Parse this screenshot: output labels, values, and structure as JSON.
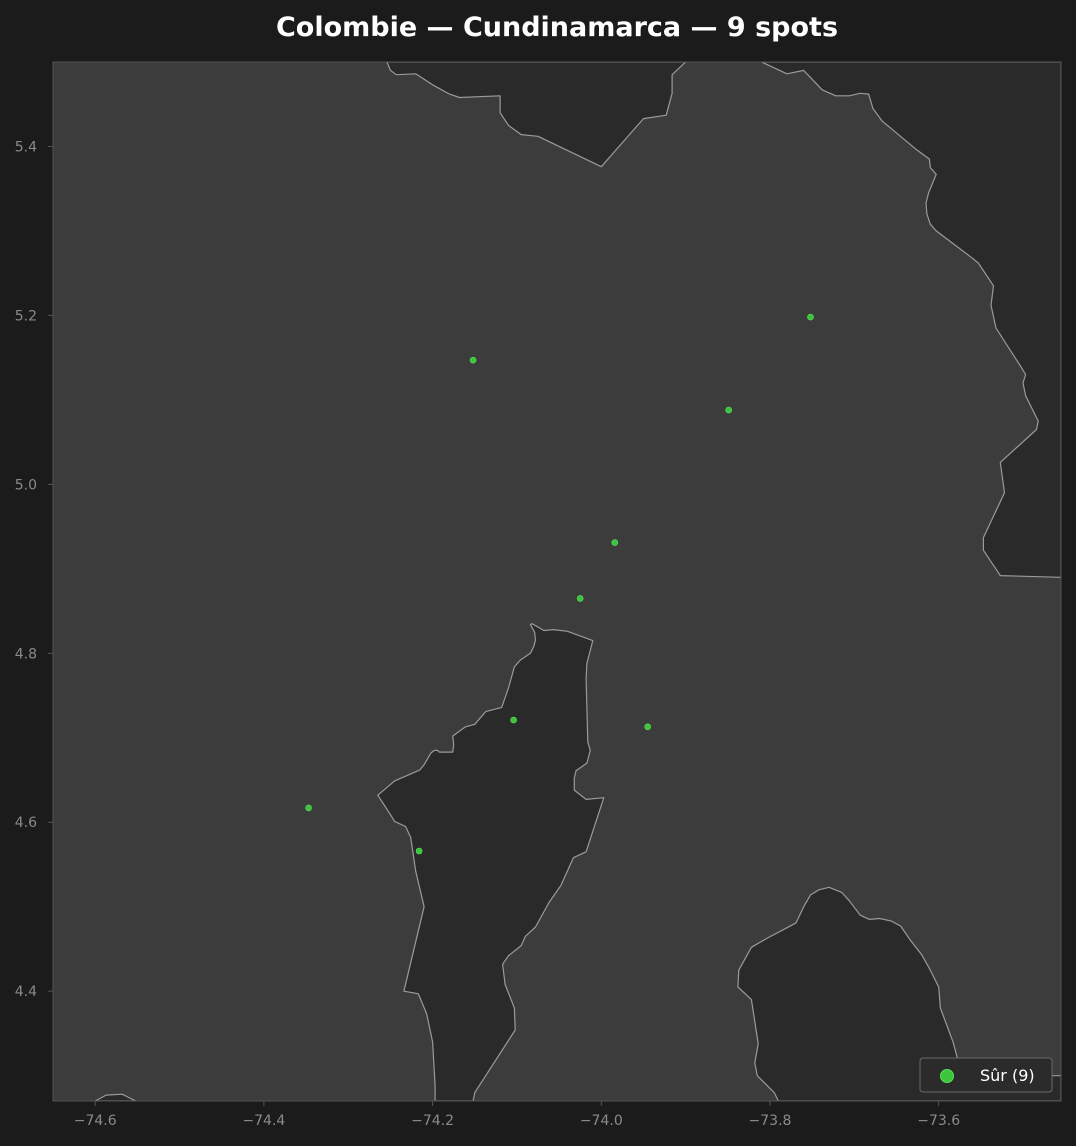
{
  "title": "Colombie — Cundinamarca — 9 spots",
  "colors": {
    "background": "#1b1b1b",
    "region_fill": "#3c3c3c",
    "neighbor_fill": "#2a2a2a",
    "border_stroke": "#9a9a9a",
    "spot": "#3cc43c",
    "spot_edge": "#5ee05e",
    "axis": "#555555",
    "tick_label": "#8a8a8a"
  },
  "chart_data": {
    "type": "scatter",
    "title": "Colombie — Cundinamarca — 9 spots",
    "xlabel": "",
    "ylabel": "",
    "xlim": [
      -74.65,
      -73.455
    ],
    "ylim": [
      4.27,
      5.5
    ],
    "x_ticks": [
      -74.6,
      -74.4,
      -74.2,
      -74.0,
      -73.8,
      -73.6
    ],
    "x_tick_labels": [
      "−74.6",
      "−74.4",
      "−74.2",
      "−74.0",
      "−73.8",
      "−73.6"
    ],
    "y_ticks": [
      4.4,
      4.6,
      4.8,
      5.0,
      5.2,
      5.4
    ],
    "y_tick_labels": [
      "4.4",
      "4.6",
      "4.8",
      "5.0",
      "5.2",
      "5.4"
    ],
    "grid": false,
    "legend_position": "bottom-right",
    "series": [
      {
        "name": "Sûr (9)",
        "color": "#3cc43c",
        "points": [
          {
            "lon": -74.152,
            "lat": 5.147
          },
          {
            "lon": -73.752,
            "lat": 5.198
          },
          {
            "lon": -73.849,
            "lat": 5.088
          },
          {
            "lon": -73.984,
            "lat": 4.931
          },
          {
            "lon": -74.025,
            "lat": 4.865
          },
          {
            "lon": -74.104,
            "lat": 4.721
          },
          {
            "lon": -73.945,
            "lat": 4.713
          },
          {
            "lon": -74.347,
            "lat": 4.617
          },
          {
            "lon": -74.216,
            "lat": 4.566
          }
        ]
      }
    ],
    "neighbor_regions": [
      {
        "name": "north-neighbor-west",
        "coords": [
          [
            -74.254,
            5.5
          ],
          [
            -74.25,
            5.49
          ],
          [
            -74.243,
            5.485
          ],
          [
            -74.22,
            5.486
          ],
          [
            -74.2,
            5.473
          ],
          [
            -74.18,
            5.462
          ],
          [
            -74.168,
            5.458
          ],
          [
            -74.12,
            5.46
          ],
          [
            -74.12,
            5.44
          ],
          [
            -74.11,
            5.425
          ],
          [
            -74.095,
            5.414
          ],
          [
            -74.075,
            5.412
          ],
          [
            -74.0,
            5.376
          ],
          [
            -73.95,
            5.433
          ],
          [
            -73.923,
            5.437
          ],
          [
            -73.916,
            5.463
          ],
          [
            -73.916,
            5.485
          ],
          [
            -73.9,
            5.5
          ]
        ]
      },
      {
        "name": "northeast-neighbor",
        "coords": [
          [
            -73.81,
            5.5
          ],
          [
            -73.78,
            5.486
          ],
          [
            -73.76,
            5.49
          ],
          [
            -73.738,
            5.467
          ],
          [
            -73.722,
            5.46
          ],
          [
            -73.706,
            5.46
          ],
          [
            -73.693,
            5.463
          ],
          [
            -73.683,
            5.462
          ],
          [
            -73.678,
            5.445
          ],
          [
            -73.667,
            5.43
          ],
          [
            -73.626,
            5.396
          ],
          [
            -73.611,
            5.385
          ],
          [
            -73.61,
            5.375
          ],
          [
            -73.603,
            5.367
          ],
          [
            -73.612,
            5.345
          ],
          [
            -73.615,
            5.333
          ],
          [
            -73.614,
            5.32
          ],
          [
            -73.61,
            5.308
          ],
          [
            -73.603,
            5.3
          ],
          [
            -73.563,
            5.27
          ],
          [
            -73.553,
            5.262
          ],
          [
            -73.535,
            5.235
          ],
          [
            -73.538,
            5.212
          ],
          [
            -73.532,
            5.185
          ],
          [
            -73.503,
            5.14
          ],
          [
            -73.497,
            5.13
          ],
          [
            -73.5,
            5.12
          ],
          [
            -73.497,
            5.105
          ],
          [
            -73.482,
            5.075
          ],
          [
            -73.484,
            5.065
          ],
          [
            -73.527,
            5.026
          ],
          [
            -73.522,
            4.99
          ],
          [
            -73.547,
            4.937
          ],
          [
            -73.547,
            4.922
          ],
          [
            -73.527,
            4.892
          ],
          [
            -73.455,
            4.89
          ],
          [
            -73.455,
            5.5
          ]
        ]
      },
      {
        "name": "bogota-district",
        "coords": [
          [
            -74.082,
            4.835
          ],
          [
            -74.068,
            4.827
          ],
          [
            -74.057,
            4.828
          ],
          [
            -74.04,
            4.826
          ],
          [
            -74.01,
            4.815
          ],
          [
            -74.017,
            4.788
          ],
          [
            -74.018,
            4.77
          ],
          [
            -74.016,
            4.695
          ],
          [
            -74.013,
            4.685
          ],
          [
            -74.017,
            4.67
          ],
          [
            -74.03,
            4.661
          ],
          [
            -74.032,
            4.652
          ],
          [
            -74.032,
            4.638
          ],
          [
            -74.018,
            4.627
          ],
          [
            -73.997,
            4.629
          ],
          [
            -74.018,
            4.565
          ],
          [
            -74.033,
            4.558
          ],
          [
            -74.048,
            4.525
          ],
          [
            -74.062,
            4.505
          ],
          [
            -74.078,
            4.476
          ],
          [
            -74.09,
            4.465
          ],
          [
            -74.095,
            4.454
          ],
          [
            -74.11,
            4.442
          ],
          [
            -74.117,
            4.432
          ],
          [
            -74.114,
            4.408
          ],
          [
            -74.103,
            4.38
          ],
          [
            -74.102,
            4.354
          ],
          [
            -74.15,
            4.28
          ],
          [
            -74.152,
            4.27
          ],
          [
            -74.197,
            4.27
          ],
          [
            -74.197,
            4.288
          ],
          [
            -74.2,
            4.34
          ],
          [
            -74.207,
            4.373
          ],
          [
            -74.214,
            4.39
          ],
          [
            -74.217,
            4.397
          ],
          [
            -74.234,
            4.4
          ],
          [
            -74.21,
            4.5
          ],
          [
            -74.22,
            4.542
          ],
          [
            -74.226,
            4.582
          ],
          [
            -74.232,
            4.595
          ],
          [
            -74.245,
            4.601
          ],
          [
            -74.25,
            4.609
          ],
          [
            -74.265,
            4.632
          ],
          [
            -74.245,
            4.649
          ],
          [
            -74.215,
            4.662
          ],
          [
            -74.21,
            4.668
          ],
          [
            -74.206,
            4.675
          ],
          [
            -74.202,
            4.682
          ],
          [
            -74.198,
            4.685
          ],
          [
            -74.194,
            4.685
          ],
          [
            -74.192,
            4.683
          ],
          [
            -74.176,
            4.683
          ],
          [
            -74.175,
            4.692
          ],
          [
            -74.176,
            4.702
          ],
          [
            -74.168,
            4.708
          ],
          [
            -74.161,
            4.713
          ],
          [
            -74.15,
            4.716
          ],
          [
            -74.137,
            4.731
          ],
          [
            -74.118,
            4.736
          ],
          [
            -74.11,
            4.759
          ],
          [
            -74.103,
            4.784
          ],
          [
            -74.096,
            4.792
          ],
          [
            -74.084,
            4.8
          ],
          [
            -74.08,
            4.808
          ],
          [
            -74.078,
            4.816
          ],
          [
            -74.079,
            4.825
          ],
          [
            -74.084,
            4.834
          ]
        ]
      },
      {
        "name": "south-neighbor-east",
        "coords": [
          [
            -73.79,
            4.27
          ],
          [
            -73.795,
            4.28
          ],
          [
            -73.815,
            4.3
          ],
          [
            -73.818,
            4.315
          ],
          [
            -73.814,
            4.338
          ],
          [
            -73.822,
            4.39
          ],
          [
            -73.838,
            4.405
          ],
          [
            -73.837,
            4.425
          ],
          [
            -73.822,
            4.452
          ],
          [
            -73.803,
            4.463
          ],
          [
            -73.78,
            4.475
          ],
          [
            -73.769,
            4.481
          ],
          [
            -73.76,
            4.5
          ],
          [
            -73.752,
            4.514
          ],
          [
            -73.742,
            4.52
          ],
          [
            -73.73,
            4.523
          ],
          [
            -73.715,
            4.517
          ],
          [
            -73.706,
            4.507
          ],
          [
            -73.693,
            4.49
          ],
          [
            -73.682,
            4.485
          ],
          [
            -73.67,
            4.486
          ],
          [
            -73.656,
            4.483
          ],
          [
            -73.645,
            4.477
          ],
          [
            -73.634,
            4.461
          ],
          [
            -73.62,
            4.443
          ],
          [
            -73.61,
            4.425
          ],
          [
            -73.6,
            4.405
          ],
          [
            -73.598,
            4.38
          ],
          [
            -73.583,
            4.34
          ],
          [
            -73.575,
            4.31
          ],
          [
            -73.57,
            4.3
          ],
          [
            -73.455,
            4.3
          ],
          [
            -73.455,
            4.27
          ]
        ]
      },
      {
        "name": "southwest-corner",
        "coords": [
          [
            -74.6,
            4.27
          ],
          [
            -74.587,
            4.277
          ],
          [
            -74.568,
            4.278
          ],
          [
            -74.552,
            4.27
          ]
        ]
      }
    ]
  }
}
